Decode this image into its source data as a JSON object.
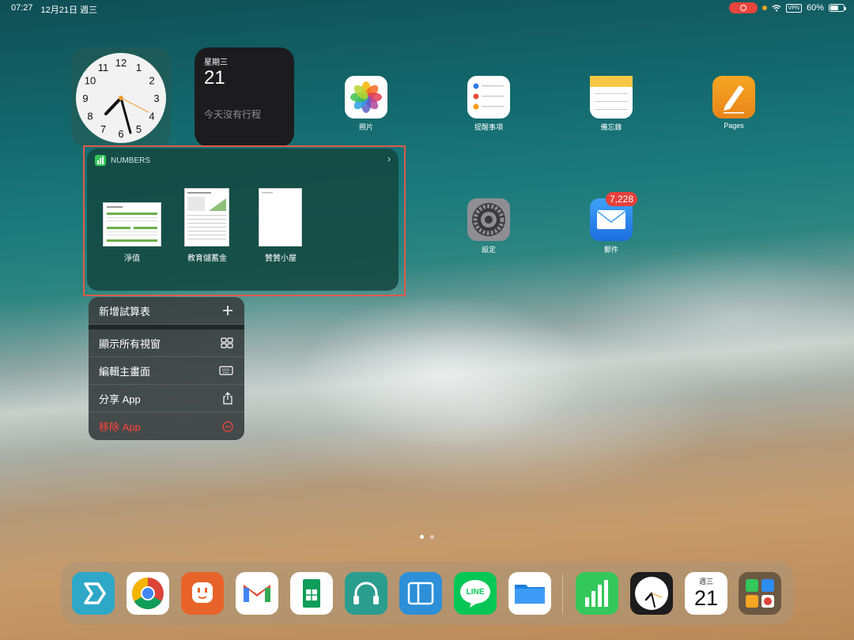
{
  "status_bar": {
    "time": "07:27",
    "date": "12月21日 週三",
    "vpn": "VPN",
    "battery": "60%",
    "battery_level": 0.6
  },
  "calendar_widget": {
    "weekday": "星期三",
    "day": "21",
    "note": "今天沒有行程"
  },
  "clock_widget": {
    "numbers": [
      "12",
      "1",
      "2",
      "3",
      "4",
      "5",
      "6",
      "7",
      "8",
      "9",
      "10",
      "11"
    ]
  },
  "apps": [
    {
      "label": "照片",
      "icon": "photos-icon"
    },
    {
      "label": "提醒事項",
      "icon": "reminders-icon"
    },
    {
      "label": "備忘錄",
      "icon": "notes-icon"
    },
    {
      "label": "Pages",
      "icon": "pages-icon"
    },
    {
      "label": "設定",
      "icon": "settings-icon"
    },
    {
      "label": "郵件",
      "icon": "mail-icon",
      "badge": "7,228"
    }
  ],
  "numbers_card": {
    "title": "NUMBERS",
    "docs": [
      {
        "label": "淨值"
      },
      {
        "label": "教育儲蓄金"
      },
      {
        "label": "贊贊小屋"
      }
    ]
  },
  "menu": {
    "new_sheet": "新增試算表",
    "show_windows": "顯示所有視窗",
    "edit_home": "編輯主畫面",
    "share_app": "分享 App",
    "remove_app": "移除 App"
  },
  "dock": {
    "apps": [
      "twister-icon",
      "chrome-icon",
      "plug-icon",
      "gmail-icon",
      "sheets-icon",
      "headphones-icon",
      "wallet-icon",
      "line-icon",
      "files-icon",
      "numbers-icon",
      "clock-icon",
      "calendar-icon",
      "app-library-icon"
    ],
    "line_label": "LINE",
    "calendar_weekday": "週三",
    "calendar_day": "21"
  },
  "colors": {
    "highlight": "#e05a48",
    "danger": "#ff453a",
    "badge": "#e5403a"
  }
}
